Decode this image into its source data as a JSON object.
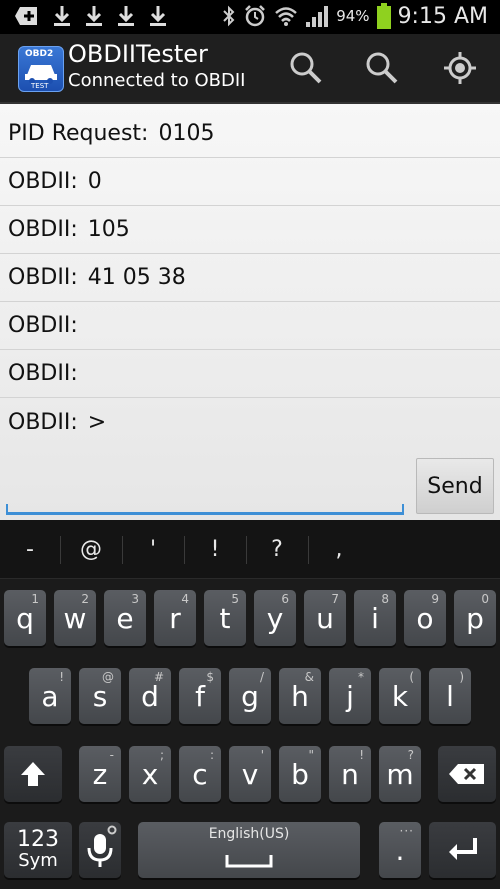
{
  "status_bar": {
    "battery_percent": "94%",
    "time": "9:15 AM",
    "icons": [
      "add-icon",
      "download-icon",
      "download-icon",
      "download-icon",
      "download-icon",
      "bluetooth-icon",
      "alarm-icon",
      "wifi-icon",
      "signal-icon",
      "battery-icon"
    ]
  },
  "action_bar": {
    "app_icon_text_top": "OBD2",
    "app_icon_text_bottom": "TEST",
    "title": "OBDIITester",
    "subtitle": "Connected to OBDII",
    "actions": [
      "search-icon",
      "search-icon",
      "target-icon"
    ]
  },
  "log": [
    {
      "label": "PID Request:",
      "value": "0105"
    },
    {
      "label": "OBDII:",
      "value": "0"
    },
    {
      "label": "OBDII:",
      "value": "105"
    },
    {
      "label": "OBDII:",
      "value": "41 05 38"
    },
    {
      "label": "OBDII:",
      "value": ""
    },
    {
      "label": "OBDII:",
      "value": ""
    },
    {
      "label": "OBDII:",
      "value": ">"
    }
  ],
  "input": {
    "value": "",
    "send_label": "Send"
  },
  "keyboard": {
    "suggestions": [
      "-",
      "@",
      "'",
      "!",
      "?",
      ","
    ],
    "row1": [
      {
        "k": "q",
        "h": "1"
      },
      {
        "k": "w",
        "h": "2"
      },
      {
        "k": "e",
        "h": "3"
      },
      {
        "k": "r",
        "h": "4"
      },
      {
        "k": "t",
        "h": "5"
      },
      {
        "k": "y",
        "h": "6"
      },
      {
        "k": "u",
        "h": "7"
      },
      {
        "k": "i",
        "h": "8"
      },
      {
        "k": "o",
        "h": "9"
      },
      {
        "k": "p",
        "h": "0"
      }
    ],
    "row2": [
      {
        "k": "a",
        "h": "!"
      },
      {
        "k": "s",
        "h": "@"
      },
      {
        "k": "d",
        "h": "#"
      },
      {
        "k": "f",
        "h": "$"
      },
      {
        "k": "g",
        "h": "/"
      },
      {
        "k": "h",
        "h": "&"
      },
      {
        "k": "j",
        "h": "*"
      },
      {
        "k": "k",
        "h": "("
      },
      {
        "k": "l",
        "h": ")"
      }
    ],
    "row3": [
      {
        "k": "z",
        "h": "-"
      },
      {
        "k": "x",
        "h": ";"
      },
      {
        "k": "c",
        "h": ":"
      },
      {
        "k": "v",
        "h": "'"
      },
      {
        "k": "b",
        "h": "\""
      },
      {
        "k": "n",
        "h": "!"
      },
      {
        "k": "m",
        "h": "?"
      }
    ],
    "sym_top": "123",
    "sym_bottom": "Sym",
    "space_label": "English(US)",
    "period": "."
  }
}
